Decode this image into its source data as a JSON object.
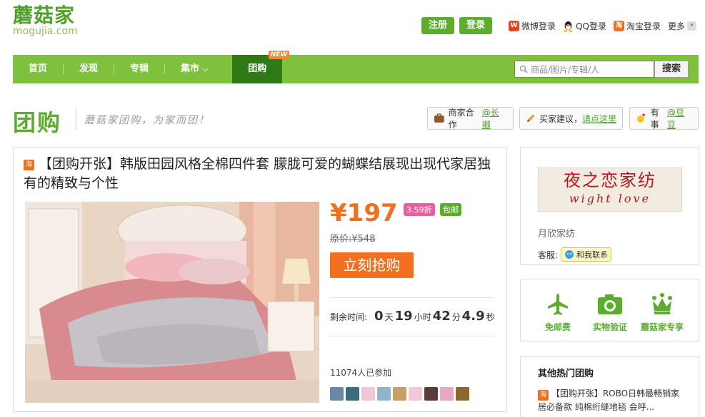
{
  "header": {
    "logo_cn": "蘑菇家",
    "logo_en": "mogujia.com",
    "register": "注册",
    "login": "登录",
    "links": [
      {
        "label": "微博登录",
        "icon": "weibo-icon",
        "color": "#e8411f"
      },
      {
        "label": "QQ登录",
        "icon": "qq-icon",
        "color": "#222222"
      },
      {
        "label": "淘宝登录",
        "icon": "taobao-icon",
        "color": "#f07020"
      }
    ],
    "more": "更多"
  },
  "nav": {
    "items": [
      "首页",
      "发现",
      "专辑",
      "集市"
    ],
    "active": "团购",
    "new_tag": "NEW",
    "search_placeholder": "商品/图片/专辑/人",
    "search_button": "搜索"
  },
  "page": {
    "title": "团购",
    "slogan": "蘑菇家团购，为家而团！",
    "merchant": {
      "label": "商家合作",
      "link": "@长卿"
    },
    "suggest": {
      "label": "买家建议，",
      "link": "请点这里"
    },
    "contact": {
      "label": "有事",
      "link": "@豆豆"
    }
  },
  "deal": {
    "badge": "淘",
    "title": "【团购开张】韩版田园风格全棉四件套 朦胧可爱的蝴蝶结展现出现代家居独有的精致与个性",
    "price": "¥197",
    "discount": "3.59折",
    "shipping": "包邮",
    "original_price": "原价:¥548",
    "buy_button": "立刻抢购",
    "remaining_label": "剩余时间:",
    "remaining": {
      "days": "0",
      "days_unit": "天",
      "hours": "19",
      "hours_unit": "小时",
      "minutes": "42",
      "minutes_unit": "分",
      "seconds": "4.9",
      "seconds_unit": "秒"
    },
    "joined": "11074人已参加"
  },
  "shop": {
    "logo_cn": "夜之恋家纺",
    "logo_en": "wight love",
    "name": "月欣家纺",
    "service_label": "客服:",
    "service_button": "和我联系"
  },
  "features": [
    {
      "label": "免邮费",
      "icon": "airplane-icon"
    },
    {
      "label": "实物验证",
      "icon": "camera-icon"
    },
    {
      "label": "蘑菇家专享",
      "icon": "crown-icon"
    }
  ],
  "hot": {
    "heading": "其他热门团购",
    "badge": "淘",
    "item": "【团购开张】ROBO日韩最畅销家居必备款 纯棉绗缝地毯 会呼..."
  },
  "colors": {
    "brand_green": "#7dc13c",
    "dark_green": "#2f7a17",
    "price_orange": "#f07020",
    "discount_pink": "#e85fa0"
  }
}
